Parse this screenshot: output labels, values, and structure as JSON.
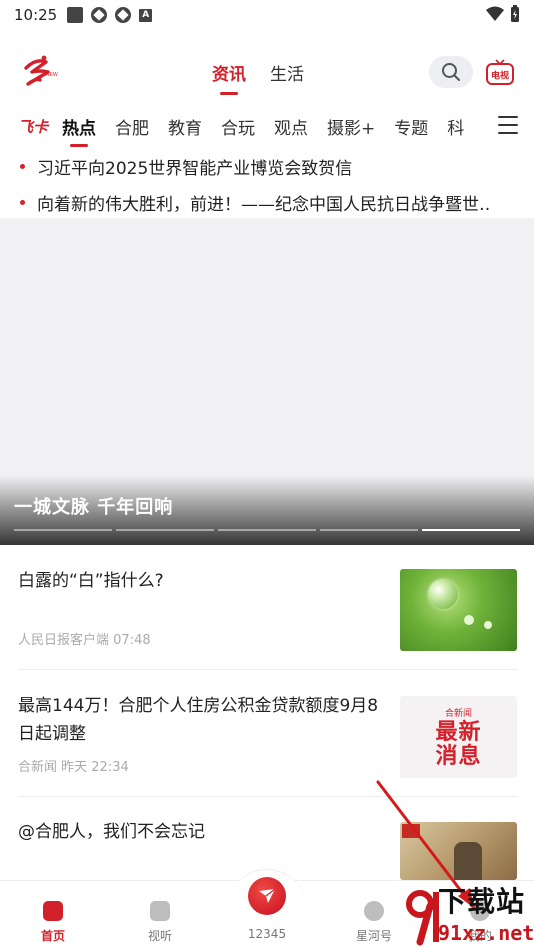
{
  "status_bar": {
    "time": "10:25"
  },
  "header": {
    "tabs": [
      {
        "label": "资讯",
        "active": true
      },
      {
        "label": "生活",
        "active": false
      }
    ],
    "tv_label": "电视"
  },
  "channels": {
    "feika_label": "飞卡",
    "items": [
      {
        "label": "热点",
        "active": true
      },
      {
        "label": "合肥"
      },
      {
        "label": "教育"
      },
      {
        "label": "合玩"
      },
      {
        "label": "观点"
      },
      {
        "label": "摄影+"
      },
      {
        "label": "专题"
      },
      {
        "label": "科"
      }
    ]
  },
  "headlines": [
    "习近平向2025世界智能产业博览会致贺信",
    "向着新的伟大胜利，前进！——纪念中国人民抗日战争暨世‥"
  ],
  "banner": {
    "caption": "一城文脉  千年回响",
    "page_count": 5,
    "current_page": 5
  },
  "news": [
    {
      "title": "白露的“白”指什么?",
      "source": "人民日报客户端",
      "time": "07:48",
      "thumb": "dewdrop-leaf"
    },
    {
      "title": "最高144万！合肥个人住房公积金贷款额度9月8日起调整",
      "source": "合新闻",
      "time": "昨天 22:34",
      "thumb": "latest-news",
      "thumb_small": "合新闻",
      "thumb_big_1": "最新",
      "thumb_big_2": "消息"
    },
    {
      "title": "@合肥人，我们不会忘记",
      "thumb": "war-memorial"
    }
  ],
  "bottom_nav": [
    {
      "label": "首页",
      "active": true
    },
    {
      "label": "视听",
      "active": false
    },
    {
      "label": "12345",
      "active": false
    },
    {
      "label": "星河号",
      "active": false
    },
    {
      "label": "我的",
      "active": false
    }
  ],
  "watermark": {
    "line1": "下载站",
    "line2": "91xz.net"
  },
  "colors": {
    "accent": "#d4202a",
    "text": "#222222",
    "muted": "#aaaaaa"
  }
}
